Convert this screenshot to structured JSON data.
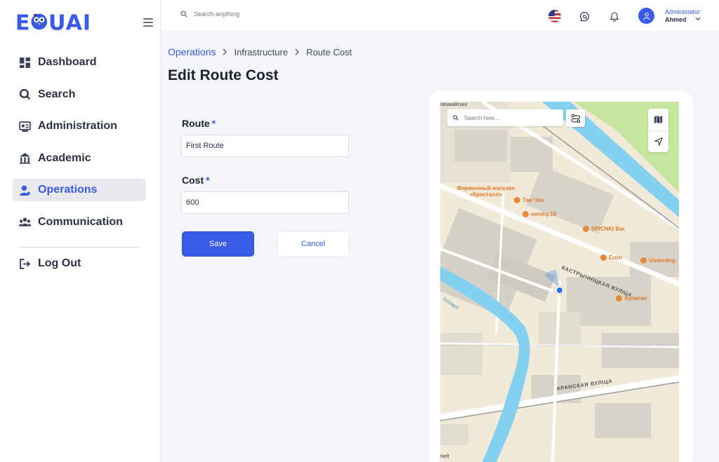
{
  "app": {
    "logo_text": "EDUAI"
  },
  "sidebar": {
    "items": [
      {
        "label": "Dashboard",
        "icon": "dashboard-icon"
      },
      {
        "label": "Search",
        "icon": "search-icon"
      },
      {
        "label": "Administration",
        "icon": "administration-icon"
      },
      {
        "label": "Academic",
        "icon": "academic-icon"
      },
      {
        "label": "Operations",
        "icon": "operations-icon",
        "active": true
      },
      {
        "label": "Communication",
        "icon": "communication-icon"
      }
    ],
    "logout_label": "Log Out"
  },
  "header": {
    "search_placeholder": "Search anything",
    "user_role": "Administator",
    "user_name": "Ahmed"
  },
  "breadcrumb": [
    "Operations",
    "Infrastructure",
    "Route Cost"
  ],
  "page_title": "Edit Route Cost",
  "form": {
    "route_label": "Route",
    "route_value": "First Route",
    "cost_label": "Cost",
    "cost_value": "600",
    "required_marker": "*",
    "save_label": "Save",
    "cancel_label": "Cancel"
  },
  "map": {
    "search_placeholder": "Search here....",
    "top_edge_text": "овомайская",
    "bottom_edge_text": "Neft",
    "pois": [
      {
        "label": "Фирменный магазин «Кристалл»"
      },
      {
        "label": "Тан Чао"
      },
      {
        "label": "vershy.19"
      },
      {
        "label": "SPICHKI Bar"
      },
      {
        "label": "Enzo"
      },
      {
        "label": "Underdog"
      },
      {
        "label": "Хулиган"
      }
    ],
    "streets": [
      "КАСТРЫЧНІЦКАЯ ВУЛІЦА",
      "АРАНСКАЯ ВУЛІЦА"
    ],
    "water_label": "Svislach"
  },
  "colors": {
    "accent": "#3a5ae8",
    "map_water": "#84d0f0",
    "map_park": "#c6e6a0",
    "poi": "#e07a2a"
  }
}
